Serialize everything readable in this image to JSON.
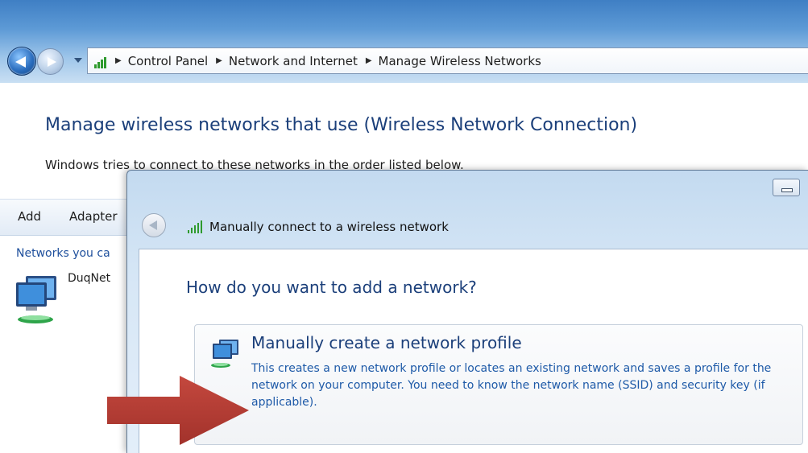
{
  "breadcrumb": [
    "Control Panel",
    "Network and Internet",
    "Manage Wireless Networks"
  ],
  "page": {
    "heading": "Manage wireless networks that use (Wireless Network Connection)",
    "subtext": "Windows tries to connect to these networks in the order listed below."
  },
  "toolbar": {
    "add_label": "Add",
    "adapter_label": "Adapter"
  },
  "networks": {
    "label": "Networks you ca",
    "items": [
      {
        "name": "DuqNet"
      }
    ]
  },
  "dialog": {
    "title": "Manually connect to a wireless network",
    "question": "How do you want to add a network?",
    "option": {
      "title": "Manually create a network profile",
      "description": "This creates a new network profile or locates an existing network and saves a profile for the network on your computer. You need to know the network name (SSID) and security key (if applicable)."
    }
  },
  "colors": {
    "heading_blue": "#1b3f7a",
    "link_blue": "#1e5aa8",
    "arrow_red": "#b03a32"
  }
}
